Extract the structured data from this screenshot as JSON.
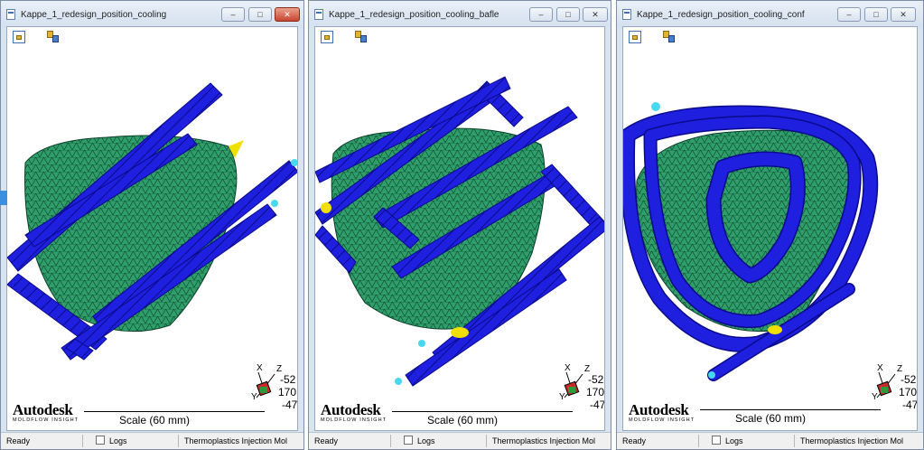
{
  "windows": [
    {
      "title": "Kappe_1_redesign_position_cooling",
      "active": true,
      "axis": {
        "x_label": "X",
        "y_label": "Y",
        "z_label": "Z",
        "values": [
          "-52",
          "170",
          "-47"
        ]
      },
      "scale": "Scale (60 mm)",
      "logo": {
        "brand": "Autodesk",
        "product": "MOLDFLOW INSIGHT"
      },
      "status": {
        "ready": "Ready",
        "logs": "Logs",
        "mode": "Thermoplastics Injection Mol"
      }
    },
    {
      "title": "Kappe_1_redesign_position_cooling_bafle",
      "active": false,
      "axis": {
        "x_label": "X",
        "y_label": "Y",
        "z_label": "Z",
        "values": [
          "-52",
          "170",
          "-47"
        ]
      },
      "scale": "Scale (60 mm)",
      "logo": {
        "brand": "Autodesk",
        "product": "MOLDFLOW INSIGHT"
      },
      "status": {
        "ready": "Ready",
        "logs": "Logs",
        "mode": "Thermoplastics Injection Mol"
      }
    },
    {
      "title": "Kappe_1_redesign_position_cooling_conf",
      "active": false,
      "axis": {
        "x_label": "X",
        "y_label": "Y",
        "z_label": "Z",
        "values": [
          "-52",
          "170",
          "-47"
        ]
      },
      "scale": "Scale (60 mm)",
      "logo": {
        "brand": "Autodesk",
        "product": "MOLDFLOW INSIGHT"
      },
      "status": {
        "ready": "Ready",
        "logs": "Logs",
        "mode": "Thermoplastics Injection Mol"
      }
    }
  ],
  "buttons": {
    "minimize": "–",
    "maximize": "□",
    "close": "✕"
  },
  "colors": {
    "part": "#2e9e6a",
    "mesh": "#0c3f2a",
    "channel": "#1f1fe0",
    "channel_edge": "#0a0a8a",
    "inlet": "#48d8ee",
    "gate": "#f0e000"
  }
}
